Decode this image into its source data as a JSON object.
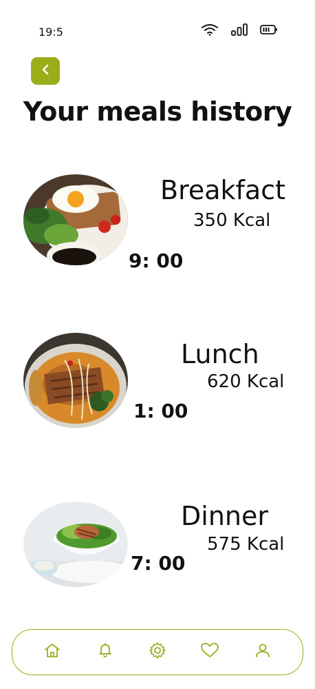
{
  "status_bar": {
    "time": "19:5",
    "icons": [
      "wifi-icon",
      "signal-icon",
      "battery-icon"
    ]
  },
  "header": {
    "back_icon": "chevron-left-icon",
    "title": "Your meals history"
  },
  "meals": [
    {
      "name": "Breakfact",
      "kcal": "350 Kcal",
      "time": "9: 00"
    },
    {
      "name": "Lunch",
      "kcal": "620 Kcal",
      "time": "1: 00"
    },
    {
      "name": "Dinner",
      "kcal": "575 Kcal",
      "time": "7: 00"
    }
  ],
  "bottom_nav": {
    "items": [
      "home-icon",
      "bell-icon",
      "gear-icon",
      "heart-icon",
      "user-icon"
    ]
  },
  "colors": {
    "accent": "#9aae1a",
    "text": "#111111",
    "background": "#ffffff"
  }
}
